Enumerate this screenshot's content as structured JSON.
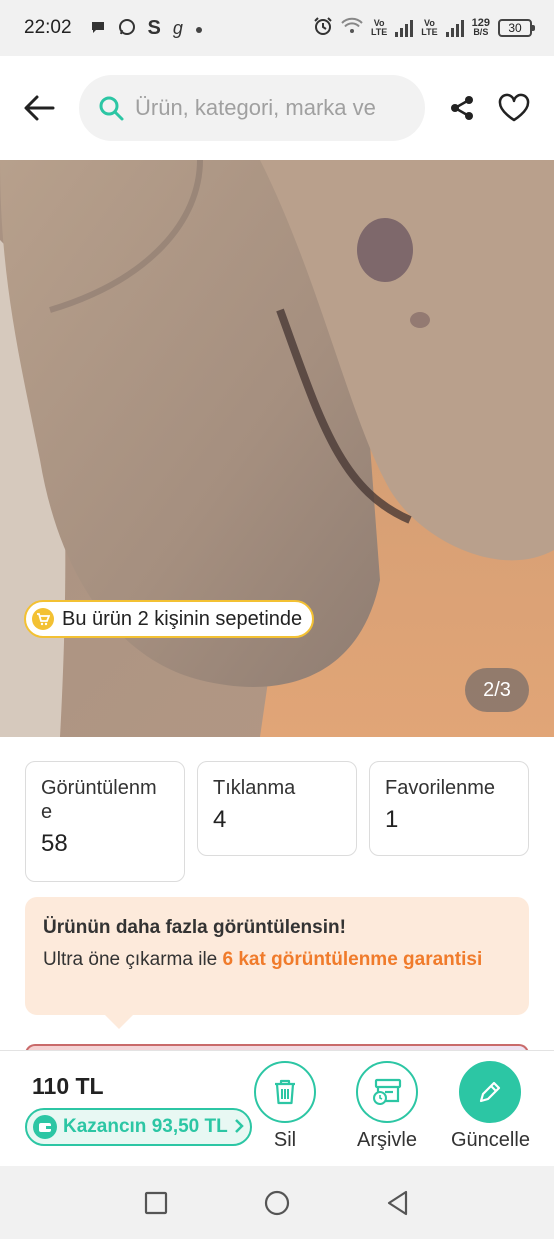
{
  "status_bar": {
    "time": "22:02",
    "volte1": "Vo\nLTE",
    "volte2": "Vo\nLTE",
    "speed_value": "129",
    "speed_unit": "B/S",
    "battery": "30",
    "left_icons": [
      "message-icon",
      "whatsapp-icon",
      "s-app-icon",
      "g-app-icon",
      "dot-icon"
    ],
    "right_icons": [
      "alarm-icon",
      "wifi-icon",
      "signal-icon",
      "signal-icon",
      "battery-icon"
    ]
  },
  "header": {
    "search_placeholder": "Ürün, kategori, marka ve",
    "icons": [
      "back-arrow-icon",
      "search-icon",
      "share-icon",
      "heart-icon"
    ]
  },
  "product_image": {
    "cart_badge": "Bu ürün 2 kişinin sepetinde",
    "pager": "2/3"
  },
  "stats": [
    {
      "label": "Görüntülenm\ne",
      "value": "58"
    },
    {
      "label": "Tıklanma",
      "value": "4"
    },
    {
      "label": "Favorilenme",
      "value": "1"
    }
  ],
  "promo": {
    "title": "Ürünün daha fazla görüntülensin!",
    "text_prefix": "Ultra öne çıkarma ile ",
    "text_highlight": "6 kat görüntülenme garantisi"
  },
  "bottom_bar": {
    "price": "110 TL",
    "earnings": "Kazancın 93,50 TL",
    "actions": [
      {
        "label": "Sil",
        "icon": "trash-icon"
      },
      {
        "label": "Arşivle",
        "icon": "archive-icon"
      },
      {
        "label": "Güncelle",
        "icon": "pencil-icon"
      }
    ]
  },
  "colors": {
    "accent": "#2cc6a4",
    "promo_bg": "#fdeadb",
    "promo_highlight": "#f07b2b",
    "badge_border": "#f3c133"
  },
  "nav_bar": {
    "icons": [
      "recent-apps-icon",
      "home-icon",
      "back-icon"
    ]
  }
}
